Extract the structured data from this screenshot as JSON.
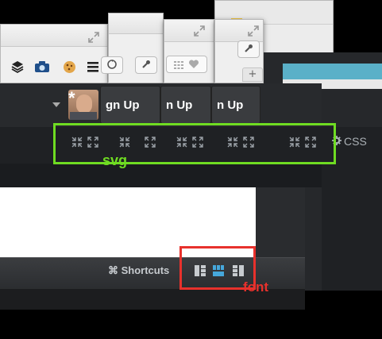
{
  "tabs": [
    {
      "label": "gn Up"
    },
    {
      "label": "n Up"
    },
    {
      "label": "n Up"
    }
  ],
  "css_button": {
    "label": "CSS"
  },
  "footer": {
    "shortcuts_label": "⌘ Shortcuts"
  },
  "annotations": {
    "svg": {
      "label": "svg",
      "color": "#6fdc22"
    },
    "font": {
      "label": "font",
      "color": "#e8312c"
    }
  },
  "colors": {
    "accent_blue": "#46a8dc",
    "teal_strip": "#5ab0c8"
  },
  "icons": {
    "extension_icons": [
      "layers-icon",
      "camera-icon",
      "cookie-icon",
      "menu-icon"
    ],
    "toolbar_icons": [
      "refresh-icon",
      "wrench-icon",
      "grid-icon",
      "heart-icon"
    ],
    "layout_icons": [
      "layout-left-icon",
      "layout-top-icon",
      "layout-right-icon"
    ]
  }
}
